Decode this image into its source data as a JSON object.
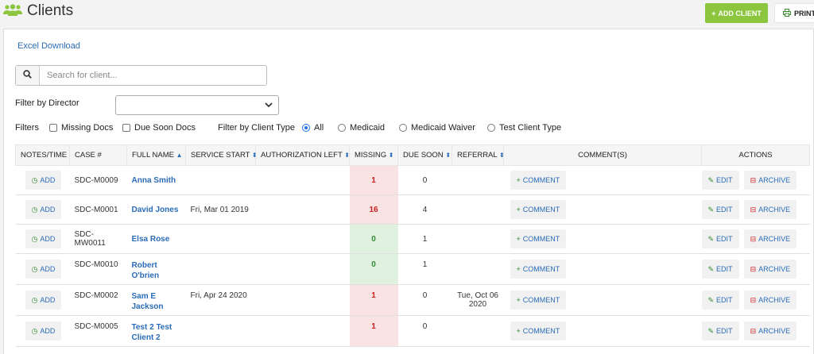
{
  "header": {
    "title": "Clients",
    "add_client_label": "ADD CLIENT",
    "print_label": "PRINT"
  },
  "toolbar": {
    "excel_download": "Excel Download",
    "search_placeholder": "Search for client...",
    "filter_director_label": "Filter by Director",
    "filter_director_value": "",
    "filters_label": "Filters",
    "missing_docs_label": "Missing Docs",
    "due_soon_docs_label": "Due Soon Docs",
    "client_type_label": "Filter by Client Type",
    "client_types": [
      "All",
      "Medicaid",
      "Medicaid Waiver",
      "Test Client Type"
    ],
    "client_type_selected": "All"
  },
  "table": {
    "headers": {
      "notes": "NOTES/TIME",
      "case": "CASE #",
      "name": "FULL NAME",
      "service_start": "SERVICE START",
      "auth_left": "AUTHORIZATION LEFT",
      "missing": "MISSING",
      "due_soon": "DUE SOON",
      "referral": "REFERRAL",
      "comments": "COMMENT(S)",
      "actions": "ACTIONS"
    },
    "labels": {
      "add": "ADD",
      "comment": "COMMENT",
      "edit": "EDIT",
      "archive": "ARCHIVE"
    },
    "rows": [
      {
        "case": "SDC-M0009",
        "name_line1": "Anna Smith",
        "name_line2": "",
        "service_start": "",
        "missing": "1",
        "missing_status": "red",
        "due_soon": "0",
        "referral_line1": "",
        "referral_line2": ""
      },
      {
        "case": "SDC-M0001",
        "name_line1": "David Jones",
        "name_line2": "",
        "service_start": "Fri, Mar 01 2019",
        "missing": "16",
        "missing_status": "red",
        "due_soon": "4",
        "referral_line1": "",
        "referral_line2": ""
      },
      {
        "case": "SDC-MW0011",
        "name_line1": "Elsa Rose",
        "name_line2": "",
        "service_start": "",
        "missing": "0",
        "missing_status": "green",
        "due_soon": "1",
        "referral_line1": "",
        "referral_line2": ""
      },
      {
        "case": "SDC-M0010",
        "name_line1": "Robert",
        "name_line2": "O'brien",
        "service_start": "",
        "missing": "0",
        "missing_status": "green",
        "due_soon": "1",
        "referral_line1": "",
        "referral_line2": ""
      },
      {
        "case": "SDC-M0002",
        "name_line1": "Sam E",
        "name_line2": "Jackson",
        "service_start": "Fri, Apr 24 2020",
        "missing": "1",
        "missing_status": "red",
        "due_soon": "0",
        "referral_line1": "Tue, Oct 06",
        "referral_line2": "2020"
      },
      {
        "case": "SDC-M0005",
        "name_line1": "Test 2 Test",
        "name_line2": "Client 2",
        "service_start": "",
        "missing": "1",
        "missing_status": "red",
        "due_soon": "0",
        "referral_line1": "",
        "referral_line2": ""
      }
    ]
  },
  "colors": {
    "accent_green": "#8cc63f",
    "link_blue": "#2a6cb8",
    "missing_red_bg": "#f8e2e2",
    "missing_green_bg": "#e1f1df"
  }
}
